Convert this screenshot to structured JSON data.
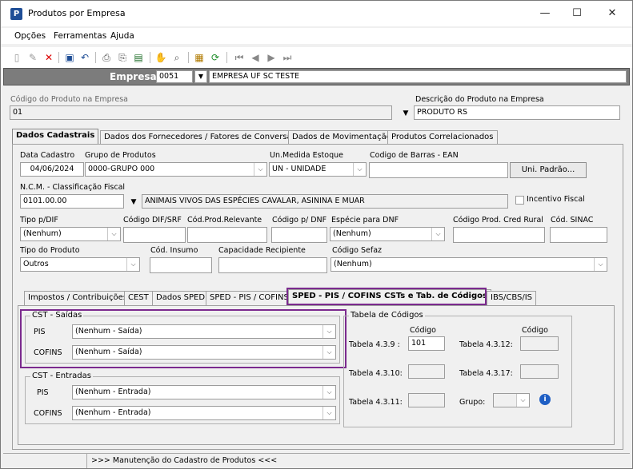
{
  "window": {
    "title": "Produtos por Empresa",
    "minimize": "—",
    "maximize": "☐",
    "close": "✕"
  },
  "menu": [
    "Opções",
    "Ferramentas",
    "Ajuda"
  ],
  "empresa": {
    "label": "Empresa",
    "code": "0051",
    "name": "EMPRESA UF SC TESTE"
  },
  "product": {
    "code_label": "Código do Produto na Empresa",
    "code": "01",
    "desc_label": "Descrição do Produto na Empresa",
    "desc": "PRODUTO RS"
  },
  "main_tabs": [
    "Dados Cadastrais",
    "Dados dos Fornecedores / Fatores de Conversão",
    "Dados de Movimentação",
    "Produtos Correlacionados"
  ],
  "cadastro": {
    "data_label": "Data Cadastro",
    "data": "04/06/2024",
    "grupo_label": "Grupo de Produtos",
    "grupo": "0000-GRUPO 000",
    "unmedida_label": "Un.Medida Estoque",
    "unmedida": "UN - UNIDADE",
    "ean_label": "Codigo de Barras - EAN",
    "ean": "",
    "uni_padrao": "Uni. Padrão...",
    "ncm_label": "N.C.M. -  Classificação Fiscal",
    "ncm": "0101.00.00",
    "ncm_desc": "ANIMAIS VIVOS DAS ESPÉCIES CAVALAR, ASININA E MUAR",
    "incentivo": "Incentivo Fiscal",
    "tipodif_label": "Tipo p/DIF",
    "tipodif": "(Nenhum)",
    "coddif_label": "Código DIF/SRF",
    "codrel_label": "Cód.Prod.Relevante",
    "coddnf_label": "Código p/ DNF",
    "especie_label": "Espécie para DNF",
    "especie": "(Nenhum)",
    "credrural_label": "Código Prod. Cred Rural",
    "sinac_label": "Cód. SINAC",
    "tipoprod_label": "Tipo do Produto",
    "tipoprod": "Outros",
    "insumo_label": "Cód. Insumo",
    "capacidade_label": "Capacidade Recipiente",
    "sefaz_label": "Código Sefaz",
    "sefaz": "(Nenhum)"
  },
  "sub_tabs": [
    "Impostos / Contribuições",
    "CEST",
    "Dados SPED",
    "SPED - PIS / COFINS",
    "SPED - PIS / COFINS CSTs e Tab. de Códigos",
    "IBS/CBS/IS"
  ],
  "cst_saidas": {
    "title": "CST - Saídas",
    "pis_label": "PIS",
    "pis": "(Nenhum - Saída)",
    "cofins_label": "COFINS",
    "cofins": "(Nenhum - Saída)"
  },
  "cst_entradas": {
    "title": "CST - Entradas",
    "pis_label": "PIS",
    "pis": "(Nenhum - Entrada)",
    "cofins_label": "COFINS",
    "cofins": "(Nenhum - Entrada)"
  },
  "tabela": {
    "title": "Tabela de Códigos",
    "codigo": "Código",
    "t439": "Tabela 4.3.9 :",
    "t439_val": "101",
    "t4312": "Tabela 4.3.12:",
    "t4310": "Tabela 4.3.10:",
    "t4317": "Tabela 4.3.17:",
    "t4311": "Tabela 4.3.11:",
    "grupo": "Grupo:"
  },
  "status": ">>> Manutenção do Cadastro de Produtos <<<",
  "colors": {
    "highlight": "#7b2a8e",
    "empresa_bar": "#7c7c7c",
    "info": "#1f5fc4"
  }
}
